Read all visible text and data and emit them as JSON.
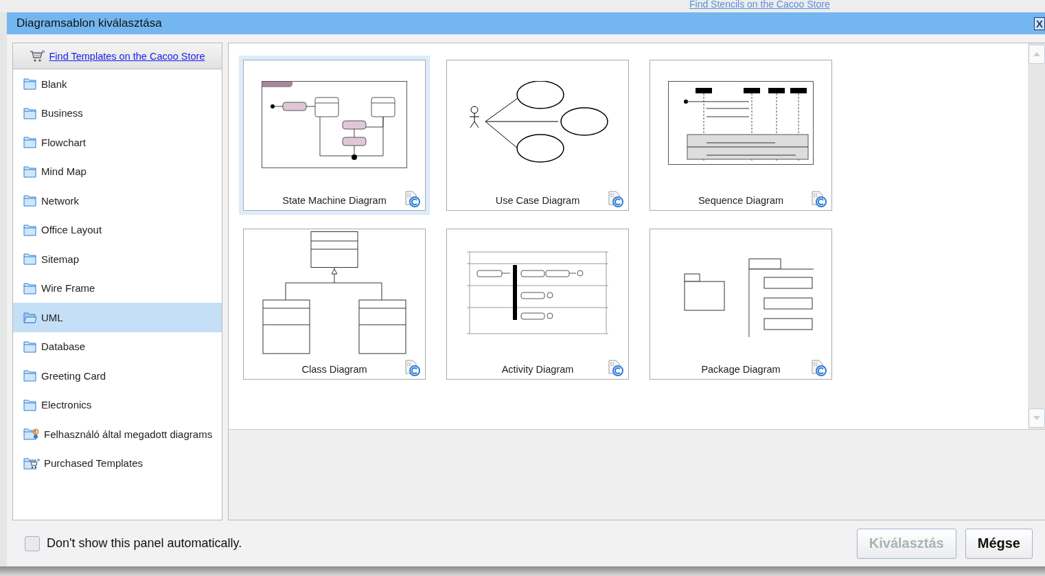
{
  "background": {
    "stencil_link": "Find Stencils on the Cacoo Store"
  },
  "window": {
    "title": "Diagramsablon kiválasztása",
    "close": "X"
  },
  "sidebar": {
    "store_link": "Find Templates on the Cacoo Store",
    "items": [
      {
        "label": "Blank",
        "kind": "folder",
        "selected": false
      },
      {
        "label": "Business",
        "kind": "folder",
        "selected": false
      },
      {
        "label": "Flowchart",
        "kind": "folder",
        "selected": false
      },
      {
        "label": "Mind Map",
        "kind": "folder",
        "selected": false
      },
      {
        "label": "Network",
        "kind": "folder",
        "selected": false
      },
      {
        "label": "Office Layout",
        "kind": "folder",
        "selected": false
      },
      {
        "label": "Sitemap",
        "kind": "folder",
        "selected": false
      },
      {
        "label": "Wire Frame",
        "kind": "folder",
        "selected": false
      },
      {
        "label": "UML",
        "kind": "folder",
        "selected": true
      },
      {
        "label": "Database",
        "kind": "folder",
        "selected": false
      },
      {
        "label": "Greeting Card",
        "kind": "folder",
        "selected": false
      },
      {
        "label": "Electronics",
        "kind": "folder",
        "selected": false
      },
      {
        "label": "Felhasználó által megadott diagrams",
        "kind": "user",
        "selected": false
      },
      {
        "label": "Purchased Templates",
        "kind": "store",
        "selected": false
      }
    ]
  },
  "templates": [
    {
      "title": "State Machine Diagram",
      "kind": "state",
      "selected": true
    },
    {
      "title": "Use Case Diagram",
      "kind": "usecase",
      "selected": false
    },
    {
      "title": "Sequence Diagram",
      "kind": "sequence",
      "selected": false
    },
    {
      "title": "Class Diagram",
      "kind": "class",
      "selected": false
    },
    {
      "title": "Activity Diagram",
      "kind": "activity",
      "selected": false
    },
    {
      "title": "Package Diagram",
      "kind": "package",
      "selected": false
    }
  ],
  "footer": {
    "checkbox": {
      "label": "Don't show this panel automatically.",
      "checked": false
    },
    "buttons": [
      {
        "label": "Kiválasztás",
        "disabled": true
      },
      {
        "label": "Mégse",
        "disabled": false
      }
    ]
  }
}
